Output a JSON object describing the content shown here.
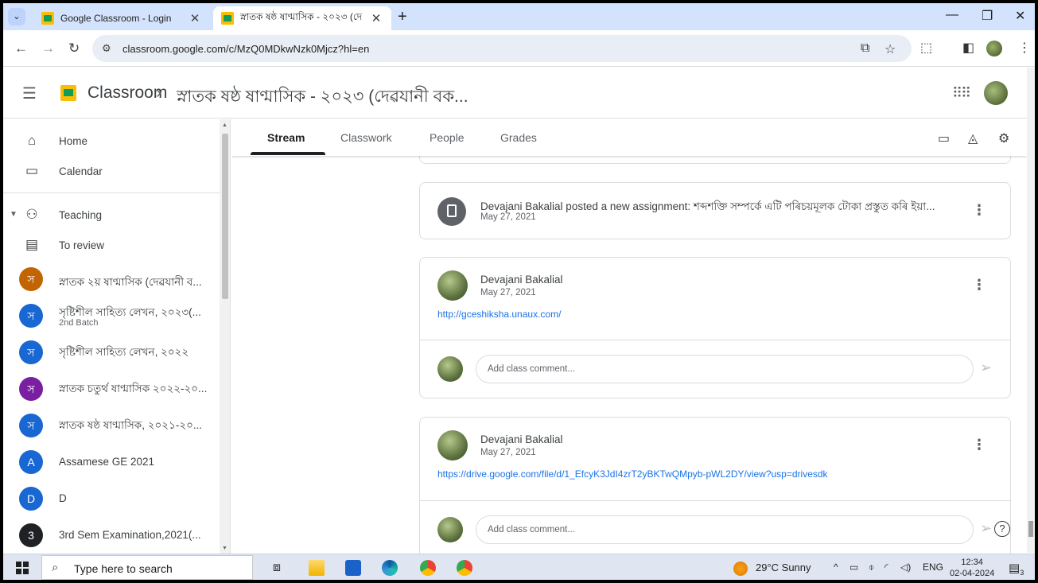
{
  "browser": {
    "tabs": [
      {
        "title": "Google Classroom - Login",
        "close": "✕"
      },
      {
        "title": "স্নাতক ষষ্ঠ ষাণ্মাসিক - ২০২৩ (দে",
        "close": "✕"
      }
    ],
    "new_tab": "+",
    "url": "classroom.google.com/c/MzQ0MDkwNzk0Mjcz?hl=en"
  },
  "header": {
    "app_name": "Classroom",
    "separator": "›",
    "class_name": "স্নাতক ষষ্ঠ ষাণ্মাসিক - ২০২৩ (দেৱযানী বক..."
  },
  "sidebar": {
    "home": "Home",
    "calendar": "Calendar",
    "teaching": "Teaching",
    "to_review": "To review",
    "courses": [
      {
        "initial": "স",
        "name": "স্নাতক ২য় ষাণ্মাসিক (দেৱযানী ব...",
        "sub": "",
        "color": "#c26401"
      },
      {
        "initial": "স",
        "name": "সৃষ্টিশীল সাহিত্য লেখন, ২০২৩(...",
        "sub": "2nd Batch",
        "color": "#1967d2"
      },
      {
        "initial": "স",
        "name": "সৃষ্টিশীল সাহিত্য লেখন, ২০২২",
        "sub": "",
        "color": "#1967d2"
      },
      {
        "initial": "স",
        "name": "স্নাতক চতুৰ্থ ষাণ্মাসিক ২০২২-২০...",
        "sub": "",
        "color": "#7b1fa2"
      },
      {
        "initial": "স",
        "name": "স্নাতক ষষ্ঠ ষাণ্মাসিক, ২০২১-২০...",
        "sub": "",
        "color": "#1967d2"
      },
      {
        "initial": "A",
        "name": "Assamese GE 2021",
        "sub": "",
        "color": "#1967d2"
      },
      {
        "initial": "D",
        "name": "D",
        "sub": "",
        "color": "#1967d2"
      },
      {
        "initial": "3",
        "name": "3rd Sem Examination,2021(...",
        "sub": "",
        "color": "#202124"
      }
    ]
  },
  "class_tabs": {
    "stream": "Stream",
    "classwork": "Classwork",
    "people": "People",
    "grades": "Grades"
  },
  "posts": [
    {
      "title": "Devajani Bakalial posted a new assignment: শব্দশক্তি সম্পৰ্কে এটি পৰিচয়মূলক টোকা প্ৰস্তুত কৰি ইয়া...",
      "date": "May 27, 2021"
    },
    {
      "author": "Devajani Bakalial",
      "date": "May 27, 2021",
      "link": "http://gceshiksha.unaux.com/",
      "comment_placeholder": "Add class comment..."
    },
    {
      "author": "Devajani Bakalial",
      "date": "May 27, 2021",
      "link": "https://drive.google.com/file/d/1_EfcyK3JdI4zrT2yBKTwQMpyb-pWL2DY/view?usp=drivesdk",
      "comment_placeholder": "Add class comment..."
    }
  ],
  "taskbar": {
    "search_placeholder": "Type here to search",
    "weather": "29°C  Sunny",
    "lang": "ENG",
    "time": "12:34",
    "date": "02-04-2024",
    "notification_count": "3"
  },
  "colors": {
    "accent": "#1a73e8",
    "tab_strip": "#d3e3fd"
  }
}
